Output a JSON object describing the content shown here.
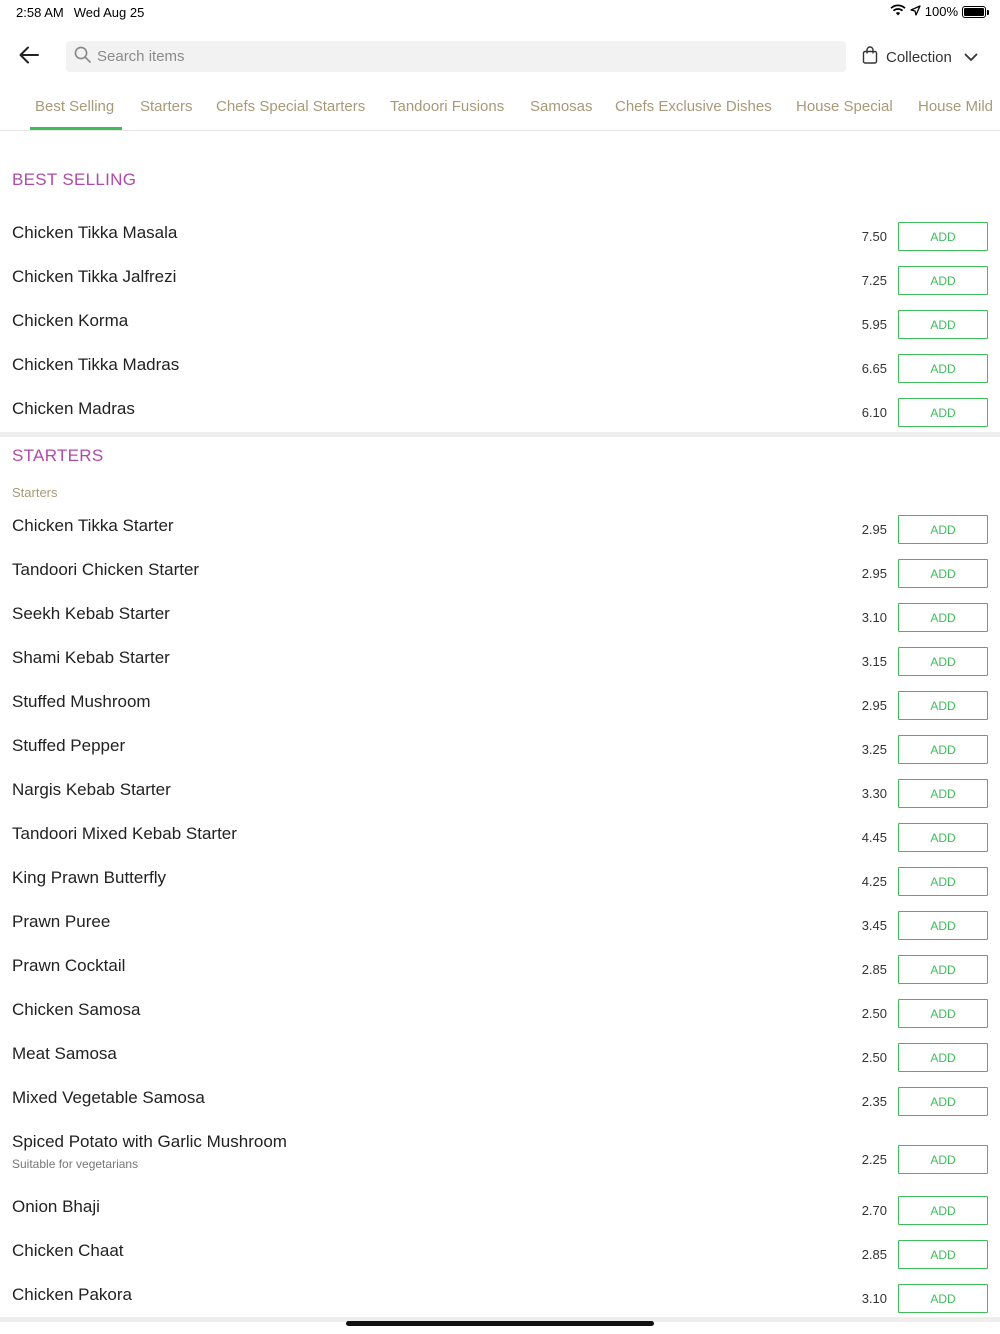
{
  "status_bar": {
    "time": "2:58 AM",
    "date": "Wed Aug 25",
    "battery": "100%",
    "battery_level": 1.0
  },
  "header": {
    "back_icon": "arrow-left-icon",
    "search_placeholder": "Search items",
    "collection_label": "Collection"
  },
  "tabs": [
    {
      "label": "Best Selling",
      "active": true
    },
    {
      "label": "Starters"
    },
    {
      "label": "Chefs Special Starters"
    },
    {
      "label": "Tandoori Fusions"
    },
    {
      "label": "Samosas"
    },
    {
      "label": "Chefs Exclusive Dishes"
    },
    {
      "label": "House Special"
    },
    {
      "label": "House Mild"
    }
  ],
  "colors": {
    "accent": "#3fbd5b",
    "section_title": "#b04aa8",
    "tab_text": "#a89a78"
  },
  "add_label": "ADD",
  "best_selling": {
    "title": "BEST SELLING",
    "items": [
      {
        "name": "Chicken Tikka Masala",
        "price": "7.50"
      },
      {
        "name": "Chicken Tikka Jalfrezi",
        "price": "7.25"
      },
      {
        "name": "Chicken Korma",
        "price": "5.95"
      },
      {
        "name": "Chicken Tikka Madras",
        "price": "6.65"
      },
      {
        "name": "Chicken Madras",
        "price": "6.10"
      }
    ]
  },
  "starters": {
    "title": "STARTERS",
    "subtitle": "Starters",
    "items": [
      {
        "name": "Chicken Tikka Starter",
        "price": "2.95"
      },
      {
        "name": "Tandoori Chicken Starter",
        "price": "2.95"
      },
      {
        "name": "Seekh Kebab Starter",
        "price": "3.10"
      },
      {
        "name": "Shami Kebab Starter",
        "price": "3.15"
      },
      {
        "name": "Stuffed Mushroom",
        "price": "2.95"
      },
      {
        "name": "Stuffed Pepper",
        "price": "3.25"
      },
      {
        "name": "Nargis Kebab Starter",
        "price": "3.30"
      },
      {
        "name": "Tandoori Mixed Kebab Starter",
        "price": "4.45"
      },
      {
        "name": "King Prawn Butterfly",
        "price": "4.25"
      },
      {
        "name": "Prawn Puree",
        "price": "3.45"
      },
      {
        "name": "Prawn Cocktail",
        "price": "2.85"
      },
      {
        "name": "Chicken Samosa",
        "price": "2.50"
      },
      {
        "name": "Meat Samosa",
        "price": "2.50"
      },
      {
        "name": "Mixed Vegetable Samosa",
        "price": "2.35"
      },
      {
        "name": "Spiced Potato with Garlic Mushroom",
        "price": "2.25",
        "description": "Suitable for vegetarians"
      },
      {
        "name": "Onion Bhaji",
        "price": "2.70"
      },
      {
        "name": "Chicken Chaat",
        "price": "2.85"
      },
      {
        "name": "Chicken Pakora",
        "price": "3.10"
      }
    ]
  }
}
